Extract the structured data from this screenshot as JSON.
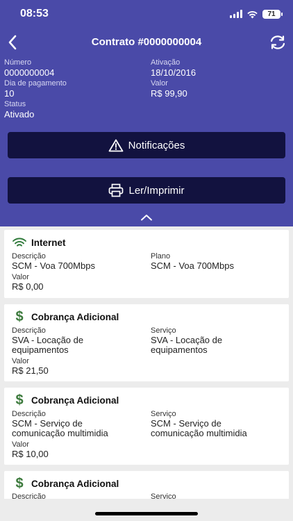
{
  "status_bar": {
    "time": "08:53",
    "battery": "71"
  },
  "header": {
    "title": "Contrato #0000000004"
  },
  "contract": {
    "numero_label": "Número",
    "numero": "0000000004",
    "ativacao_label": "Ativação",
    "ativacao": "18/10/2016",
    "dia_label": "Dia de pagamento",
    "dia": "10",
    "valor_label": "Valor",
    "valor": "R$ 99,90",
    "status_label": "Status",
    "status": "Ativado"
  },
  "buttons": {
    "notificacoes": "Notificações",
    "ler_imprimir": "Ler/Imprimir"
  },
  "cards": [
    {
      "title": "Internet",
      "icon": "wifi-icon",
      "descricao_label": "Descrição",
      "descricao": "SCM - Voa 700Mbps",
      "right_label": "Plano",
      "right_value": "SCM - Voa 700Mbps",
      "valor_label": "Valor",
      "valor": "R$ 0,00"
    },
    {
      "title": "Cobrança Adicional",
      "icon": "dollar-icon",
      "descricao_label": "Descrição",
      "descricao_1": "SVA - Locação de",
      "descricao_2": "equipamentos",
      "right_label": "Serviço",
      "right_value_1": "SVA - Locação de",
      "right_value_2": "equipamentos",
      "valor_label": "Valor",
      "valor": "R$ 21,50"
    },
    {
      "title": "Cobrança Adicional",
      "icon": "dollar-icon",
      "descricao_label": "Descrição",
      "descricao_1": "SCM - Serviço de",
      "descricao_2": "comunicação multimidia",
      "right_label": "Serviço",
      "right_value_1": "SCM - Serviço de",
      "right_value_2": "comunicação multimidia",
      "valor_label": "Valor",
      "valor": "R$ 10,00"
    },
    {
      "title": "Cobrança Adicional",
      "icon": "dollar-icon",
      "descricao_label": "Descrição",
      "right_label": "Serviço"
    }
  ],
  "colors": {
    "header_bg": "#4a4aa8",
    "button_bg": "#12123f",
    "dollar_green": "#3c7a3c"
  }
}
